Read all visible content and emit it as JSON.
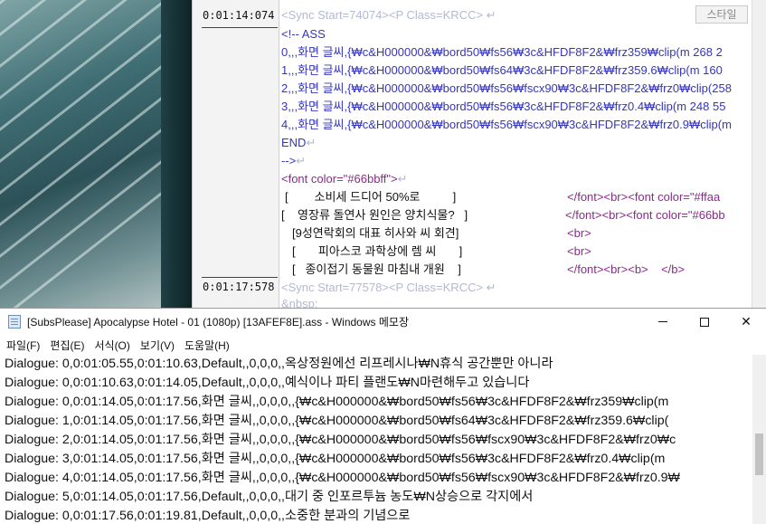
{
  "editor_panel": {
    "timestamps": [
      "0:01:14:074",
      "0:01:17:578"
    ],
    "style_button": "스타일",
    "lines": [
      "<Sync Start=74074><P Class=KRCC>",
      "<!-- ASS",
      "0,,,화면 글씨,{₩c&H000000&₩bord50₩fs56₩3c&HFDF8F2&₩frz359₩clip(m 268 2",
      "1,,,화면 글씨,{₩c&H000000&₩bord50₩fs64₩3c&HFDF8F2&₩frz359.6₩clip(m 160",
      "2,,,화면 글씨,{₩c&H000000&₩bord50₩fs56₩fscx90₩3c&HFDF8F2&₩frz0₩clip(258",
      "3,,,화면 글씨,{₩c&H000000&₩bord50₩fs56₩3c&HFDF8F2&₩frz0.4₩clip(m 248 55",
      "4,,,화면 글씨,{₩c&H000000&₩bord50₩fs56₩fscx90₩3c&HFDF8F2&₩frz0.9₩clip(m",
      "END",
      "-->",
      "<font color=\"#66bbff\">",
      "[        소비세 드디어 50%로          ]",
      "[    영장류 돌연사 원인은 양치식물?   ]",
      "[9성연락회의 대표 히사와 씨 회견]",
      "[       피아스코 과학상에 렘 씨       ]",
      "[   종이접기 동물원 마침내 개원    ]",
      "<Sync Start=77578><P Class=KRCC>",
      "&nbsp;"
    ],
    "right_fragments": [
      "</font><br><font color=\"#ffaa",
      "</font><br><font color=\"#66bb",
      "<br>",
      "<br>",
      "</font><br><b>    </b>"
    ]
  },
  "notepad": {
    "title": "[SubsPlease] Apocalypse Hotel - 01 (1080p) [13AFEF8E].ass - Windows 메모장",
    "menu": [
      "파일(F)",
      "편집(E)",
      "서식(O)",
      "보기(V)",
      "도움말(H)"
    ],
    "lines": [
      "Dialogue: 0,0:01:05.55,0:01:10.63,Default,,0,0,0,,옥상정원에선 리프레시나₩N휴식 공간뿐만 아니라",
      "Dialogue: 0,0:01:10.63,0:01:14.05,Default,,0,0,0,,예식이나 파티 플랜도₩N마련해두고 있습니다",
      "Dialogue: 0,0:01:14.05,0:01:17.56,화면 글씨,,0,0,0,,{₩c&H000000&₩bord50₩fs56₩3c&HFDF8F2&₩frz359₩clip(m",
      "Dialogue: 1,0:01:14.05,0:01:17.56,화면 글씨,,0,0,0,,{₩c&H000000&₩bord50₩fs64₩3c&HFDF8F2&₩frz359.6₩clip(",
      "Dialogue: 2,0:01:14.05,0:01:17.56,화면 글씨,,0,0,0,,{₩c&H000000&₩bord50₩fs56₩fscx90₩3c&HFDF8F2&₩frz0₩c",
      "Dialogue: 3,0:01:14.05,0:01:17.56,화면 글씨,,0,0,0,,{₩c&H000000&₩bord50₩fs56₩3c&HFDF8F2&₩frz0.4₩clip(m",
      "Dialogue: 4,0:01:14.05,0:01:17.56,화면 글씨,,0,0,0,,{₩c&H000000&₩bord50₩fs56₩fscx90₩3c&HFDF8F2&₩frz0.9₩",
      "Dialogue: 5,0:01:14.05,0:01:17.56,Default,,0,0,0,,대기 중 인포르투늄 농도₩N상승으로 각지에서",
      "Dialogue: 0,0:01:17.56,0:01:19.81,Default,,0,0,0,,소중한 분과의 기념으로"
    ]
  },
  "colors": {
    "faint_tag": "#b4b9d2",
    "ass_text": "#3535c0",
    "font_tag": "#8b2a8b",
    "link": "#1a1ad0"
  }
}
